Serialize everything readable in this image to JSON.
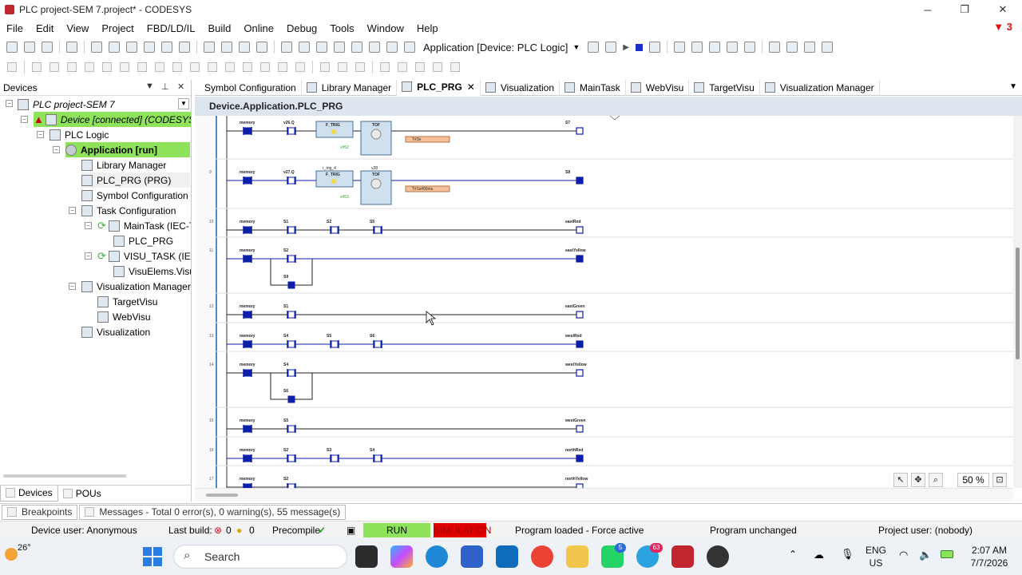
{
  "window": {
    "title": "PLC project-SEM 7.project* - CODESYS",
    "minimize": "─",
    "maximize": "❐",
    "close": "✕"
  },
  "menu": {
    "items": [
      "File",
      "Edit",
      "View",
      "Project",
      "FBD/LD/IL",
      "Build",
      "Online",
      "Debug",
      "Tools",
      "Window",
      "Help"
    ],
    "alert_count": "3"
  },
  "toolbar": {
    "application_label": "Application [Device: PLC Logic]"
  },
  "devices_panel": {
    "title": "Devices",
    "tree": [
      {
        "label": "PLC project-SEM 7",
        "italic": true
      },
      {
        "label": "Device [connected] (CODESYS Co",
        "italic": true,
        "highlight": true
      },
      {
        "label": "PLC Logic"
      },
      {
        "label": "Application [run]",
        "bold": true,
        "highlight": true
      },
      {
        "label": "Library Manager"
      },
      {
        "label": "PLC_PRG (PRG)",
        "selected": true
      },
      {
        "label": "Symbol Configuration"
      },
      {
        "label": "Task Configuration"
      },
      {
        "label": "MainTask (IEC-Ta"
      },
      {
        "label": "PLC_PRG"
      },
      {
        "label": "VISU_TASK (IEC"
      },
      {
        "label": "VisuElems.Visu_"
      },
      {
        "label": "Visualization Manager"
      },
      {
        "label": "TargetVisu"
      },
      {
        "label": "WebVisu"
      },
      {
        "label": "Visualization"
      }
    ],
    "bottom_tabs": [
      "Devices",
      "POUs"
    ]
  },
  "doc_tabs": [
    {
      "label": "Symbol Configuration"
    },
    {
      "label": "Library Manager"
    },
    {
      "label": "PLC_PRG",
      "active": true
    },
    {
      "label": "Visualization"
    },
    {
      "label": "MainTask"
    },
    {
      "label": "WebVisu"
    },
    {
      "label": "TargetVisu"
    },
    {
      "label": "Visualization Manager"
    }
  ],
  "editor": {
    "path": "Device.Application.PLC_PRG",
    "zoom": "50 %",
    "networks": [
      {
        "num": "",
        "contacts": [
          "memory",
          "v26.Q"
        ],
        "coil": "S7",
        "block": "F_TRIG",
        "timer": "TOF",
        "time_value": "T#3s",
        "pt_var": "v#52"
      },
      {
        "num": "9",
        "contacts": [
          "memory",
          "v27.Q"
        ],
        "coil": "S8",
        "block": "F_TRIG",
        "block_inst": "r_trig_4",
        "timer": "TOF",
        "timer_inst": "v28",
        "time_value": "T#1s400ms",
        "pt_var": "v#53"
      },
      {
        "num": "10",
        "contacts": [
          "memory",
          "S1",
          "S2",
          "S5"
        ],
        "coil": "eastRed"
      },
      {
        "num": "11",
        "contacts": [
          "memory",
          "S2"
        ],
        "branch": "S9",
        "coil": "eastYellow"
      },
      {
        "num": "12",
        "contacts": [
          "memory",
          "S1"
        ],
        "coil": "eastGreen"
      },
      {
        "num": "13",
        "contacts": [
          "memory",
          "S4",
          "S5",
          "S6"
        ],
        "coil": "westRed"
      },
      {
        "num": "14",
        "contacts": [
          "memory",
          "S4"
        ],
        "branch": "S6",
        "coil": "westYellow"
      },
      {
        "num": "15",
        "contacts": [
          "memory",
          "S5"
        ],
        "coil": "westGreen"
      },
      {
        "num": "16",
        "contacts": [
          "memory",
          "S2",
          "S3",
          "S4"
        ],
        "coil": "northRed"
      },
      {
        "num": "17",
        "contacts": [
          "memory",
          "S2"
        ],
        "coil": "northYellow"
      }
    ]
  },
  "messages_bar": {
    "breakpoints": "Breakpoints",
    "messages": "Messages - Total 0 error(s), 0 warning(s), 55 message(s)"
  },
  "status": {
    "device_user": "Device user: Anonymous",
    "last_build_label": "Last build:",
    "errors": "0",
    "warnings": "0",
    "precompile": "Precompile",
    "run": "RUN",
    "simulation": "SIMULATION",
    "program_loaded": "Program loaded - Force active",
    "program_state": "Program unchanged",
    "project_user": "Project user: (nobody)"
  },
  "taskbar": {
    "weather": "26°",
    "search_placeholder": "Search",
    "lang_top": "ENG",
    "lang_bottom": "US",
    "time": "2:07 AM",
    "date": "7/7/2026",
    "whatsapp_badge": "5",
    "telegram_badge": "63"
  },
  "colors": {
    "green_highlight": "#8ee35a",
    "sim_red": "#e00000",
    "ladder_blue": "#0d1fa8",
    "editor_header": "#dde6ee"
  }
}
